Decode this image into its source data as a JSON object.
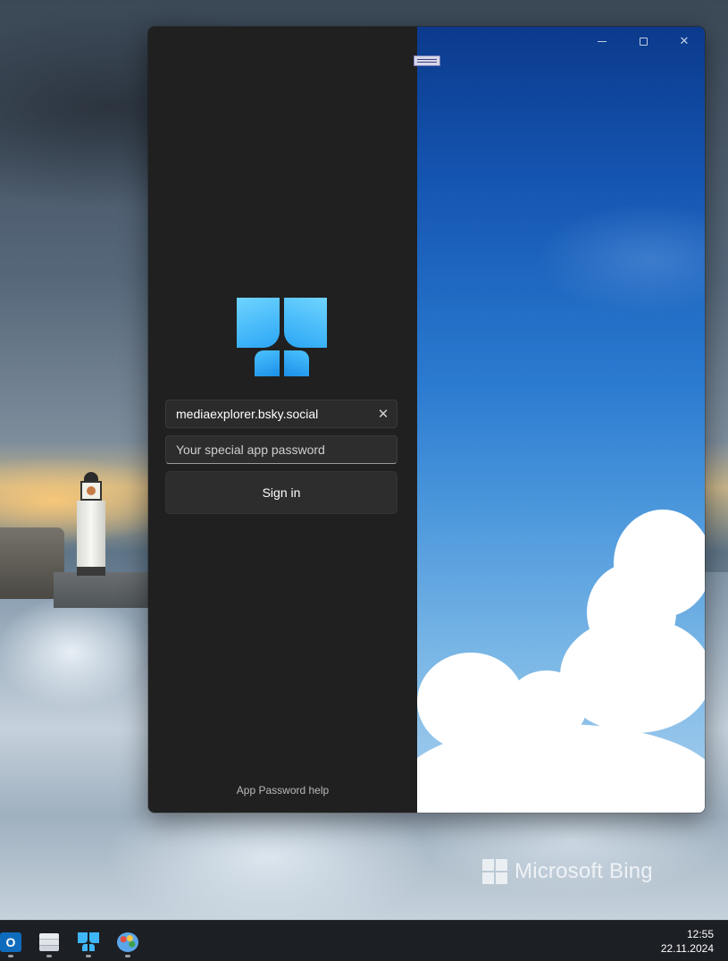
{
  "login": {
    "handle_value": "mediaexplorer.bsky.social",
    "password_placeholder": "Your special app password",
    "signin_label": "Sign in",
    "help_link": "App Password help"
  },
  "window_controls": {
    "minimize": "minimize-icon",
    "maximize": "maximize-icon",
    "close": "close-icon"
  },
  "desktop": {
    "watermark": "Microsoft Bing"
  },
  "taskbar": {
    "apps": [
      "outlook-icon",
      "file-explorer-icon",
      "butterfly-app-icon",
      "paint-icon"
    ],
    "time": "12:55",
    "date": "22.11.2024"
  },
  "colors": {
    "accent": "#2aa6f5",
    "pane_background": "#202020"
  }
}
